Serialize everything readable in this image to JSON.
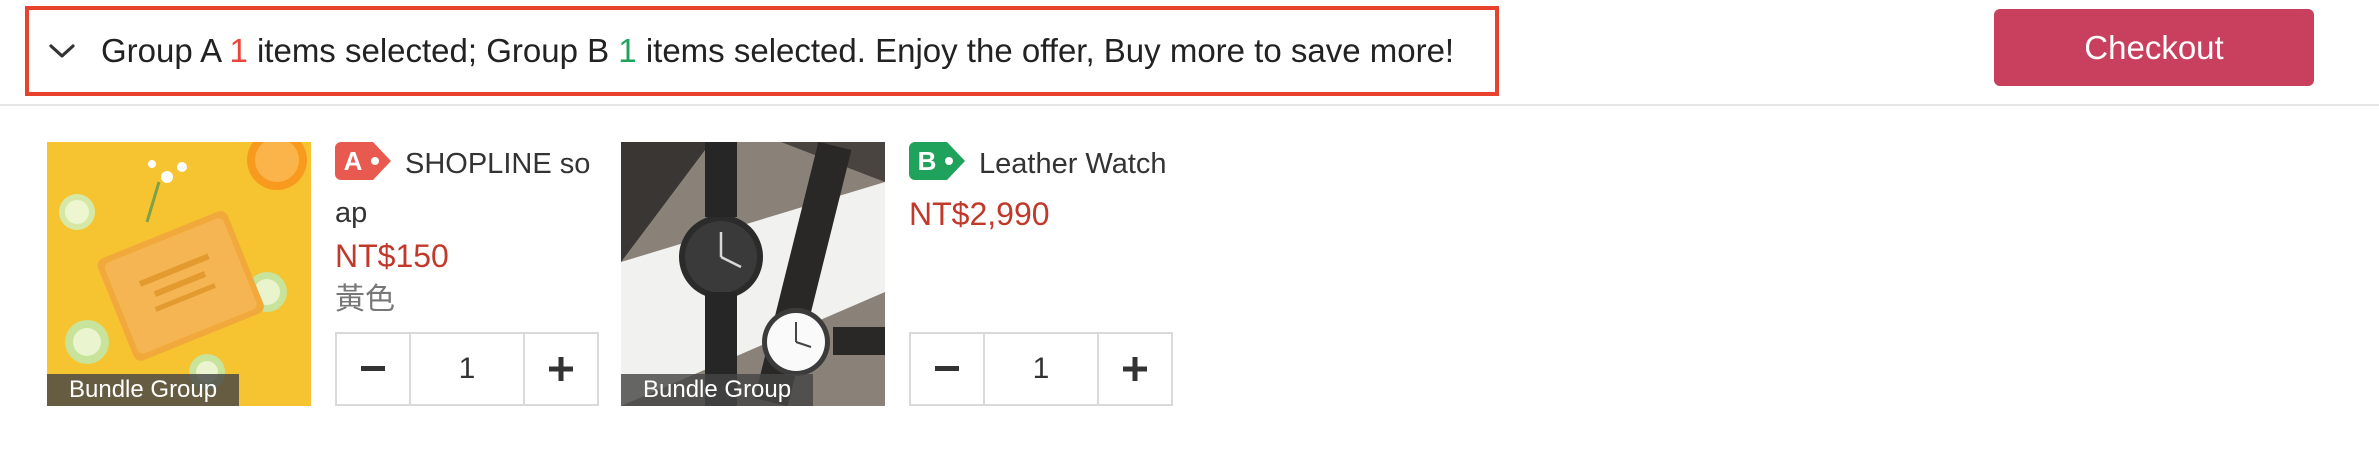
{
  "summary": {
    "part1": "Group A ",
    "count_a": "1",
    "part2": " items selected; Group B ",
    "count_b": "1",
    "part3": " items selected. Enjoy the offer, Buy more to save more!",
    "toggle_icon": "chevron-down-icon"
  },
  "checkout_label": "Checkout",
  "items": [
    {
      "group_badge": "A",
      "group_color": "#e85a4f",
      "title": "SHOPLINE soap",
      "price": "NT$150",
      "variant": "黃色",
      "quantity": "1",
      "bundle_label": "Bundle Group",
      "image": "yellow-soap-image"
    },
    {
      "group_badge": "B",
      "group_color": "#1fa35c",
      "title": "Leather Watch",
      "price": "NT$2,990",
      "variant": "",
      "quantity": "1",
      "bundle_label": "Bundle Group",
      "image": "leather-watch-image"
    }
  ],
  "colors": {
    "accent_red": "#e9453a",
    "accent_green": "#1fa35c",
    "checkout_bg": "#c8405e",
    "price": "#c0392b"
  }
}
